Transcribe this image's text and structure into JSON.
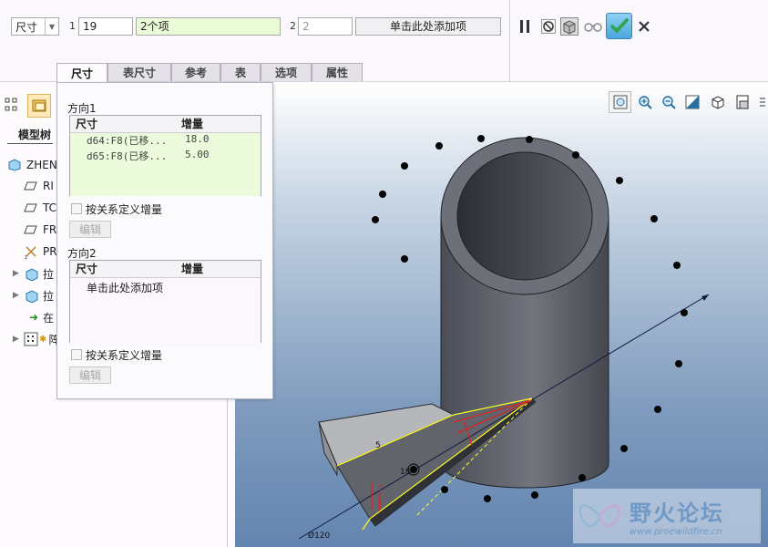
{
  "dashboard": {
    "type_select": "尺寸",
    "dir1_num": "1",
    "dir1_count": "19",
    "dir1_collector": "2个项",
    "dir2_num": "2",
    "dir2_count": "2",
    "dir2_collector": "单击此处添加项"
  },
  "tabs": [
    "尺寸",
    "表尺寸",
    "参考",
    "表",
    "选项",
    "属性"
  ],
  "tree": {
    "tab_label": "模型树",
    "items": [
      "ZHEN",
      "RI",
      "TC",
      "FR",
      "PR",
      "拉",
      "拉",
      "在",
      "阵"
    ]
  },
  "popup": {
    "dir1_label": "方向1",
    "dir1_headers": [
      "尺寸",
      "增量"
    ],
    "dir1_rows": [
      {
        "dim": "d64:F8(已移...",
        "inc": "18.0"
      },
      {
        "dim": "d65:F8(已移...",
        "inc": "5.00"
      }
    ],
    "relation_checkbox": "按关系定义增量",
    "edit_button": "编辑",
    "dir2_label": "方向2",
    "dir2_headers": [
      "尺寸",
      "增量"
    ],
    "dir2_placeholder": "单击此处添加项",
    "relation_checkbox2": "按关系定义增量",
    "edit_button2": "编辑"
  },
  "graphics": {
    "dim_5": "5",
    "dim_18": "18",
    "dim_dia": "Ø120"
  },
  "watermark": {
    "title": "野火论坛",
    "url": "www.proewildfire.cn"
  },
  "colors": {
    "accent": "#2fa34a",
    "collector": "#eafbd8",
    "background_bottom": "#6485b0"
  }
}
